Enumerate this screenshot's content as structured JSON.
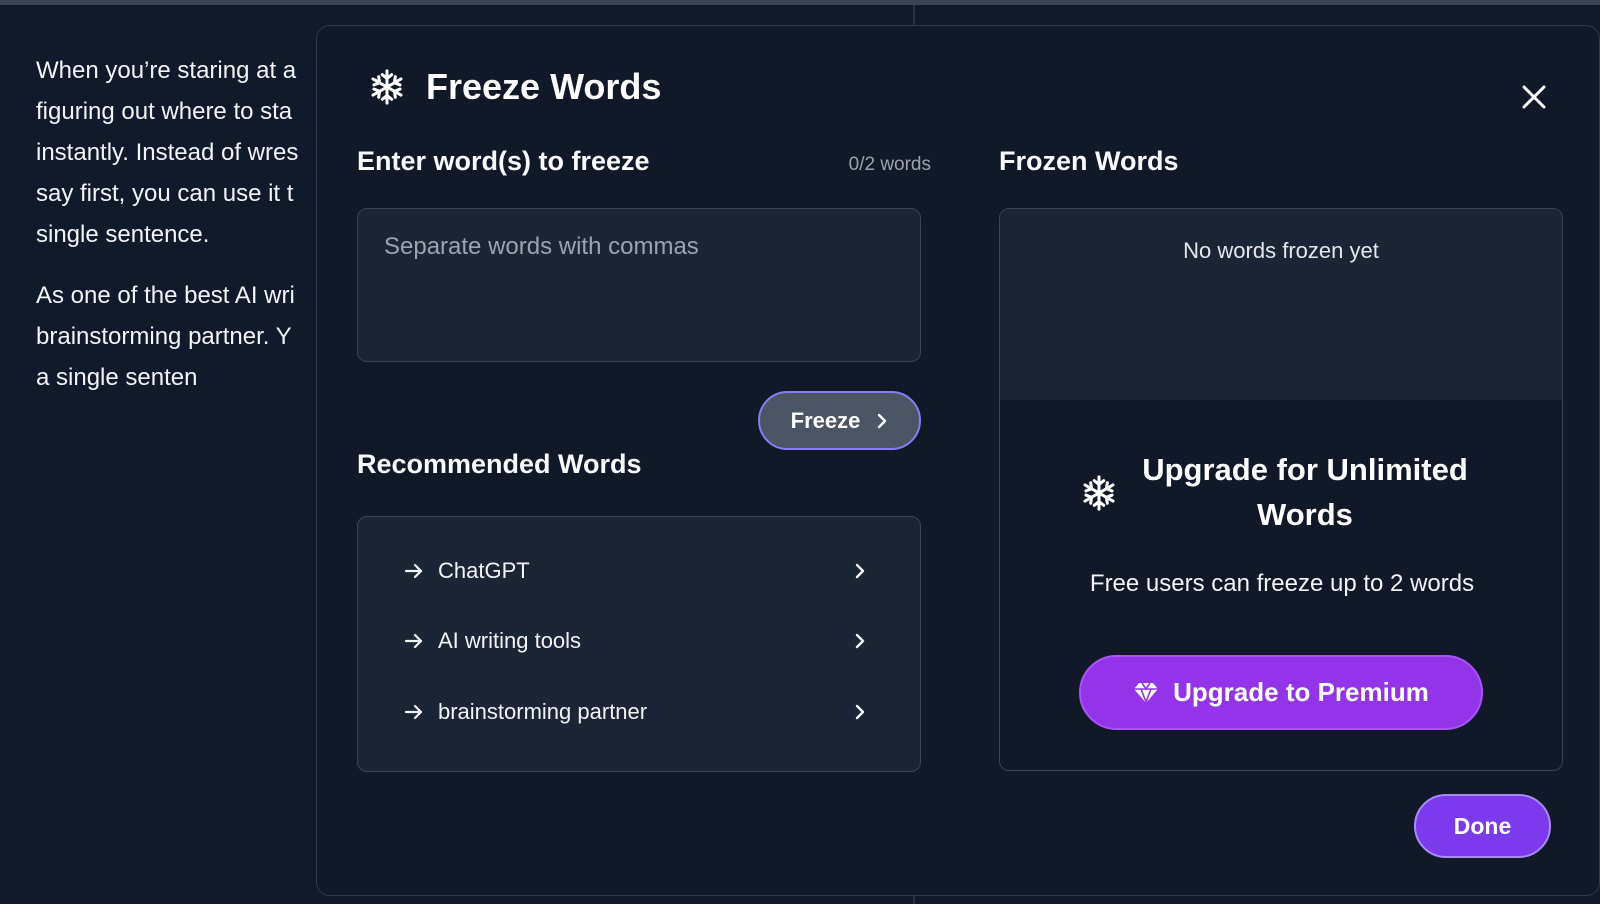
{
  "background": {
    "paragraph1": [
      "When you’re staring at a",
      "figuring out where to sta",
      "instantly. Instead of wres",
      "say first, you can use it t",
      "single sentence."
    ],
    "paragraph2": [
      "As one of the best AI wri",
      "brainstorming partner. Y",
      "a single senten"
    ]
  },
  "modal": {
    "title": "Freeze Words",
    "title_icon": "snowflake-icon",
    "close_icon": "close-icon",
    "input_section": {
      "title": "Enter word(s) to freeze",
      "count": "0/2 words",
      "placeholder": "Separate words with commas",
      "value": "",
      "freeze_label": "Freeze"
    },
    "recommended": {
      "title": "Recommended Words",
      "items": [
        {
          "label": "ChatGPT"
        },
        {
          "label": "AI writing tools"
        },
        {
          "label": "brainstorming partner"
        }
      ]
    },
    "frozen": {
      "title": "Frozen Words",
      "empty_message": "No words frozen yet",
      "upgrade_title": "Upgrade for Unlimited Words",
      "upgrade_subtitle": "Free users can freeze up to 2 words",
      "premium_label": "Upgrade to Premium",
      "premium_icon": "diamond-icon"
    },
    "done_label": "Done"
  },
  "colors": {
    "background": "#111a2b",
    "modal": "#111827",
    "premium": "#9333ea",
    "done": "#7c3aed"
  }
}
